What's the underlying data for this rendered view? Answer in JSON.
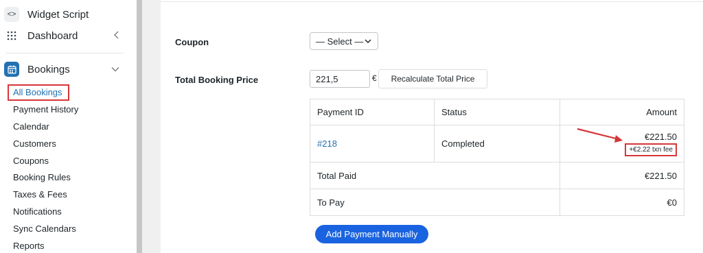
{
  "sidebar": {
    "top_items": [
      {
        "label": "Widget Script",
        "icon": "code-icon"
      },
      {
        "label": "Dashboard",
        "icon": "grid-icon"
      }
    ],
    "bookings": {
      "label": "Bookings",
      "icon": "calendar-icon"
    },
    "sub_items": [
      {
        "label": "All Bookings"
      },
      {
        "label": "Payment History"
      },
      {
        "label": "Calendar"
      },
      {
        "label": "Customers"
      },
      {
        "label": "Coupons"
      },
      {
        "label": "Booking Rules"
      },
      {
        "label": "Taxes & Fees"
      },
      {
        "label": "Notifications"
      },
      {
        "label": "Sync Calendars"
      },
      {
        "label": "Reports"
      }
    ]
  },
  "form": {
    "coupon_label": "Coupon",
    "coupon_select_value": "— Select —",
    "total_price_label": "Total Booking Price",
    "total_price_value": "221,5",
    "currency_symbol": "€",
    "recalculate_label": "Recalculate Total Price"
  },
  "payments": {
    "headers": {
      "id": "Payment ID",
      "status": "Status",
      "amount": "Amount"
    },
    "row": {
      "id": "#218",
      "status": "Completed",
      "amount": "€221.50",
      "fee": "+€2.22 txn fee"
    },
    "total_paid_label": "Total Paid",
    "total_paid_value": "€221.50",
    "to_pay_label": "To Pay",
    "to_pay_value": "€0"
  },
  "add_payment_label": "Add Payment Manually",
  "colors": {
    "accent": "#2271b1",
    "button": "#1a63e0",
    "highlight": "#d63638"
  }
}
